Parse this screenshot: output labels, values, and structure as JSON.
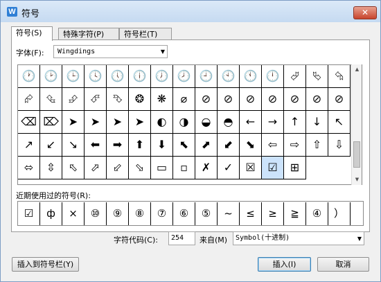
{
  "window": {
    "title": "符号",
    "app_icon": "W",
    "close_label": "✕"
  },
  "tabs": [
    "符号(S)",
    "特殊字符(P)",
    "符号栏(T)"
  ],
  "font": {
    "label": "字体(F):",
    "value": "Wingdings"
  },
  "symbols": [
    [
      "🕐",
      "🕑",
      "🕒",
      "🕓",
      "🕔",
      "🕕",
      "🕖",
      "🕗",
      "🕘",
      "🕙",
      "🕚",
      "🕛",
      "⮰",
      "⮱",
      "⮲"
    ],
    [
      "⮳",
      "⮴",
      "⮵",
      "⮶",
      "⮷",
      "❂",
      "❋",
      "⌀",
      "⊘",
      "⊘",
      "⊘",
      "⊘",
      "⊘",
      "⊘",
      "⊘"
    ],
    [
      "⌫",
      "⌦",
      "➤",
      "➤",
      "➤",
      "➤",
      "◐",
      "◑",
      "◒",
      "◓",
      "←",
      "→",
      "↑",
      "↓",
      "↖"
    ],
    [
      "↗",
      "↙",
      "↘",
      "⬅",
      "➡",
      "⬆",
      "⬇",
      "⬉",
      "⬈",
      "⬋",
      "⬊",
      "⇦",
      "⇨",
      "⇧",
      "⇩"
    ],
    [
      "⬄",
      "⇳",
      "⬁",
      "⬀",
      "⬃",
      "⬂",
      "▭",
      "▫",
      "✗",
      "✓",
      "☒",
      "☑",
      "⊞"
    ]
  ],
  "selected_symbol": "☑",
  "recent": {
    "label": "近期使用过的符号(R):",
    "items": [
      "☑",
      "ф",
      "×",
      "⑩",
      "⑨",
      "⑧",
      "⑦",
      "⑥",
      "⑤",
      "~",
      "≤",
      "≥",
      "≧",
      "④",
      "）"
    ]
  },
  "char_code": {
    "label": "字符代码(C):",
    "value": "254"
  },
  "from": {
    "label": "来自(M)",
    "value": "Symbol(十进制)"
  },
  "buttons": {
    "insert_bar": "插入到符号栏(Y)",
    "insert": "插入(I)",
    "cancel": "取消"
  }
}
